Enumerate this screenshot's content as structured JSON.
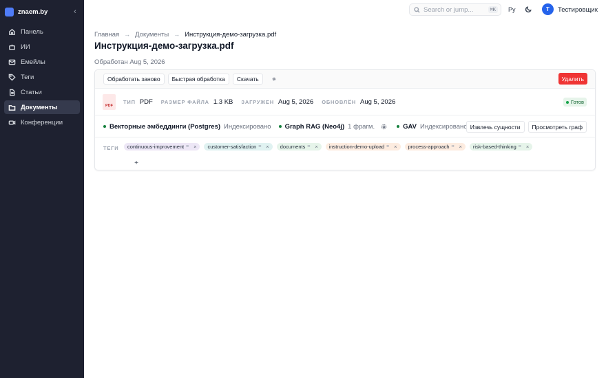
{
  "app": {
    "name": "znaem.by",
    "brand_color": "#4f7cf7"
  },
  "sidebar": {
    "items": [
      {
        "label": "Панель",
        "icon": "home-icon"
      },
      {
        "label": "ИИ",
        "icon": "robot-icon"
      },
      {
        "label": "Емейлы",
        "icon": "mail-icon"
      },
      {
        "label": "Теги",
        "icon": "tag-icon"
      },
      {
        "label": "Статьи",
        "icon": "article-icon"
      },
      {
        "label": "Документы",
        "icon": "folder-icon",
        "active": true
      },
      {
        "label": "Конференции",
        "icon": "video-icon"
      }
    ]
  },
  "topbar": {
    "search_placeholder": "Search or jump...",
    "search_shortcut": "⌘K",
    "language": "Ру",
    "user_initial": "T",
    "user_name": "Тестировщик"
  },
  "breadcrumb": {
    "items": [
      "Главная",
      "Документы",
      "Инструкция-демо-загрузка.pdf"
    ]
  },
  "page": {
    "title": "Инструкция-демо-загрузка.pdf",
    "processed": "Обработан Aug 5, 2026"
  },
  "toolbar": {
    "reprocess": "Обработать заново",
    "quick_process": "Быстрая обработка",
    "download": "Скачать",
    "delete": "Удалить"
  },
  "meta": {
    "file_badge": "PDF",
    "type_label": "ТИП",
    "type_value": "PDF",
    "size_label": "РАЗМЕР ФАЙЛА",
    "size_value": "1.3 KB",
    "uploaded_label": "ЗАГРУЖЕН",
    "uploaded_value": "Aug 5, 2026",
    "updated_label": "ОБНОВЛЁН",
    "updated_value": "Aug 5, 2026",
    "status": "Готов"
  },
  "indexes": {
    "vector_name": "Векторные эмбеддинги (Postgres)",
    "vector_state": "Индексировано",
    "graph_name": "Graph RAG (Neo4j)",
    "graph_state": "1 фрагм.",
    "gav_name": "GAV",
    "gav_state": "Индексировано",
    "extract_button": "Извлечь сущности",
    "view_graph_button": "Просмотреть граф"
  },
  "tags": {
    "label": "ТЕГИ",
    "items": [
      {
        "label": "continuous-improvement",
        "color": "#ede7f6"
      },
      {
        "label": "customer-satisfaction",
        "color": "#e0f2f1"
      },
      {
        "label": "documents",
        "color": "#e6f4ea"
      },
      {
        "label": "instruction-demo-upload",
        "color": "#fdece0"
      },
      {
        "label": "process-approach",
        "color": "#fdece0"
      },
      {
        "label": "risk-based-thinking",
        "color": "#e6f4ea"
      }
    ],
    "add_label": "+"
  }
}
